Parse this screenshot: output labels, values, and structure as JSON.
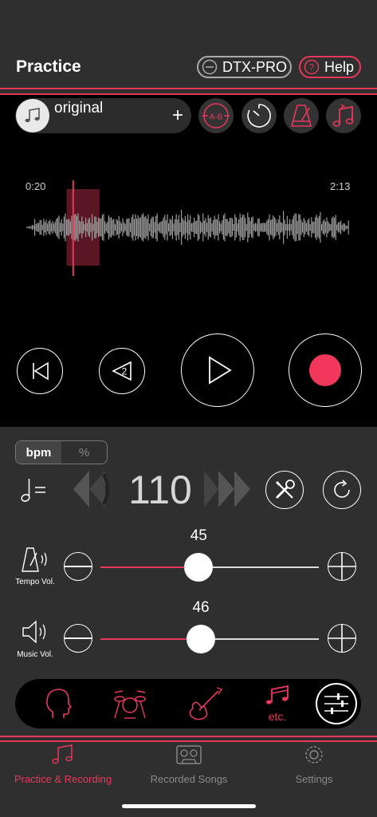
{
  "header": {
    "title": "Practice",
    "dtx_label": "DTX-PRO",
    "help_label": "Help"
  },
  "song": {
    "name": "original",
    "add_symbol": "+"
  },
  "toolbar": {
    "ab_label": "A-B"
  },
  "waveform": {
    "start_time": "0:20",
    "end_time": "2:13",
    "playhead_fraction": 0.15,
    "loop_start_fraction": 0.13,
    "loop_end_fraction": 0.23
  },
  "transport": {
    "rewind_steps": "2"
  },
  "tempo": {
    "mode_bpm": "bpm",
    "mode_percent": "%",
    "note_symbol": "♩=",
    "value": "110"
  },
  "tempo_volume": {
    "value": "45",
    "fraction": 0.45,
    "label": "Tempo Vol."
  },
  "music_volume": {
    "value": "46",
    "fraction": 0.46,
    "label": "Music Vol."
  },
  "instruments": {
    "etc_label": "etc."
  },
  "tabs": [
    {
      "label": "Practice & Recording",
      "active": true
    },
    {
      "label": "Recorded Songs",
      "active": false
    },
    {
      "label": "Settings",
      "active": false
    }
  ],
  "colors": {
    "accent": "#e8385a",
    "panel": "#2f2f2f",
    "inactive": "#8a8a8a"
  }
}
